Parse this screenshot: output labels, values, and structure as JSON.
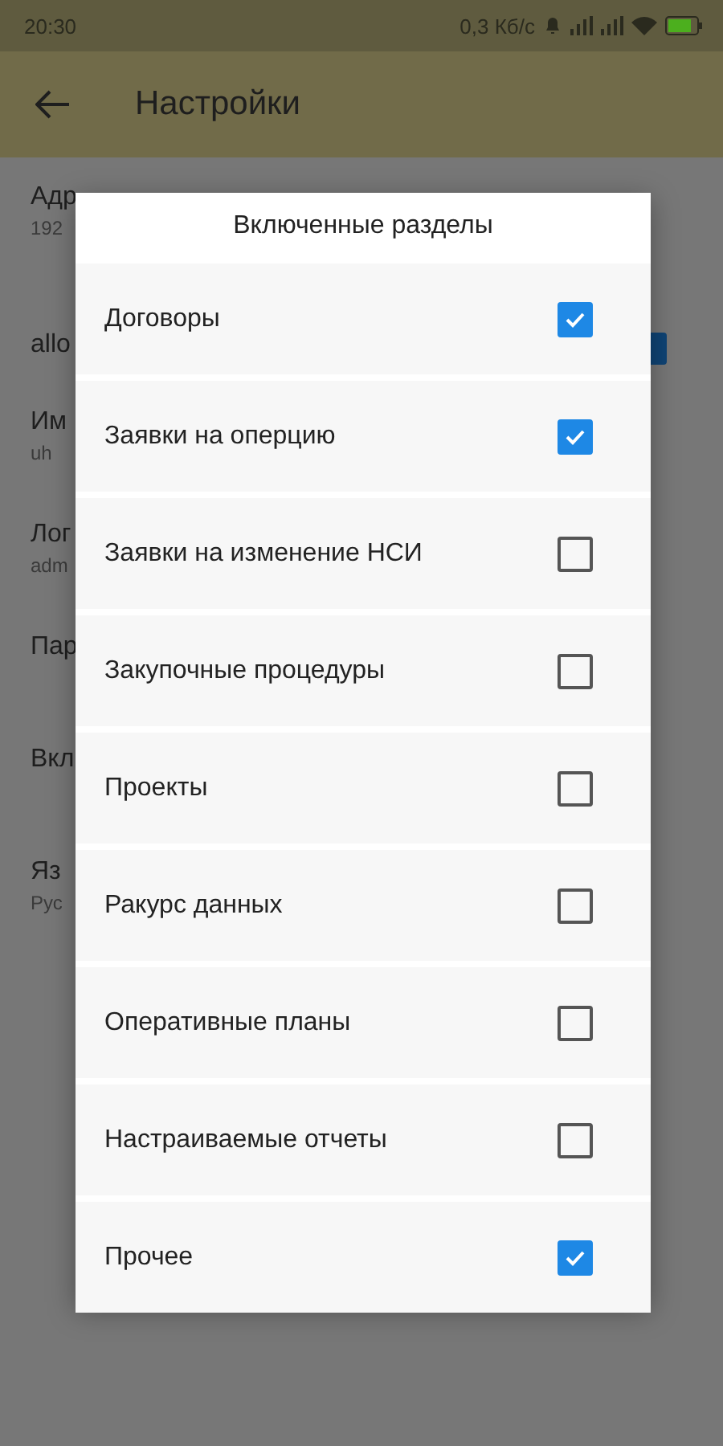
{
  "status_bar": {
    "time": "20:30",
    "speed": "0,3 Кб/с"
  },
  "app_bar": {
    "title": "Настройки"
  },
  "background_items": [
    {
      "title": "Адр",
      "subtitle": "192"
    },
    {
      "title": "allo",
      "checked": true
    },
    {
      "title": "Им",
      "subtitle": "uh"
    },
    {
      "title": "Лог",
      "subtitle": "adm"
    },
    {
      "title": "Пар"
    },
    {
      "title": "Вкл"
    },
    {
      "title": "Яз",
      "subtitle": "Рус"
    }
  ],
  "dialog": {
    "title": "Включенные разделы",
    "options": [
      {
        "label": "Договоры",
        "checked": true
      },
      {
        "label": "Заявки на оперцию",
        "checked": true
      },
      {
        "label": "Заявки на изменение НСИ",
        "checked": false
      },
      {
        "label": "Закупочные процедуры",
        "checked": false
      },
      {
        "label": "Проекты",
        "checked": false
      },
      {
        "label": "Ракурс данных",
        "checked": false
      },
      {
        "label": "Оперативные планы",
        "checked": false
      },
      {
        "label": "Настраиваемые отчеты",
        "checked": false
      },
      {
        "label": "Прочее",
        "checked": true
      }
    ]
  }
}
